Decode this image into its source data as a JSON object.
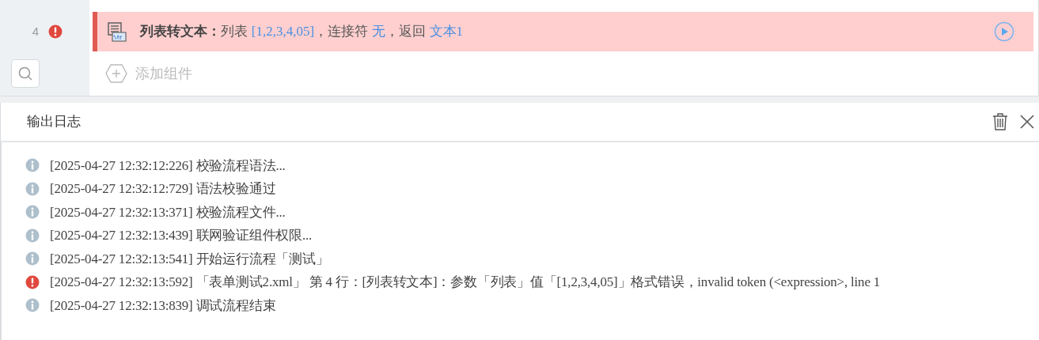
{
  "flow": {
    "step": {
      "number": "4",
      "error": true,
      "title": "列表转文本：",
      "parts": [
        {
          "kind": "text",
          "text": "列表 "
        },
        {
          "kind": "value",
          "text": "[1,2,3,4,05]"
        },
        {
          "kind": "text",
          "text": "，连接符 "
        },
        {
          "kind": "value",
          "text": "无"
        },
        {
          "kind": "text",
          "text": "，返回 "
        },
        {
          "kind": "value",
          "text": "文本1"
        }
      ]
    },
    "add_label": "添加组件"
  },
  "log": {
    "title": "输出日志",
    "entries": [
      {
        "kind": "info",
        "text": "[2025-04-27 12:32:12:226] 校验流程语法..."
      },
      {
        "kind": "info",
        "text": "[2025-04-27 12:32:12:729] 语法校验通过"
      },
      {
        "kind": "info",
        "text": "[2025-04-27 12:32:13:371] 校验流程文件..."
      },
      {
        "kind": "info",
        "text": "[2025-04-27 12:32:13:439] 联网验证组件权限..."
      },
      {
        "kind": "info",
        "text": "[2025-04-27 12:32:13:541] 开始运行流程「测试」"
      },
      {
        "kind": "error",
        "text": "[2025-04-27 12:32:13:592] 「表单测试2.xml」 第 4 行：[列表转文本]：参数「列表」值「[1,2,3,4,05]」格式错误，invalid token (<expression>, line 1"
      },
      {
        "kind": "info",
        "text": "[2025-04-27 12:32:13:839] 调试流程结束"
      }
    ]
  }
}
